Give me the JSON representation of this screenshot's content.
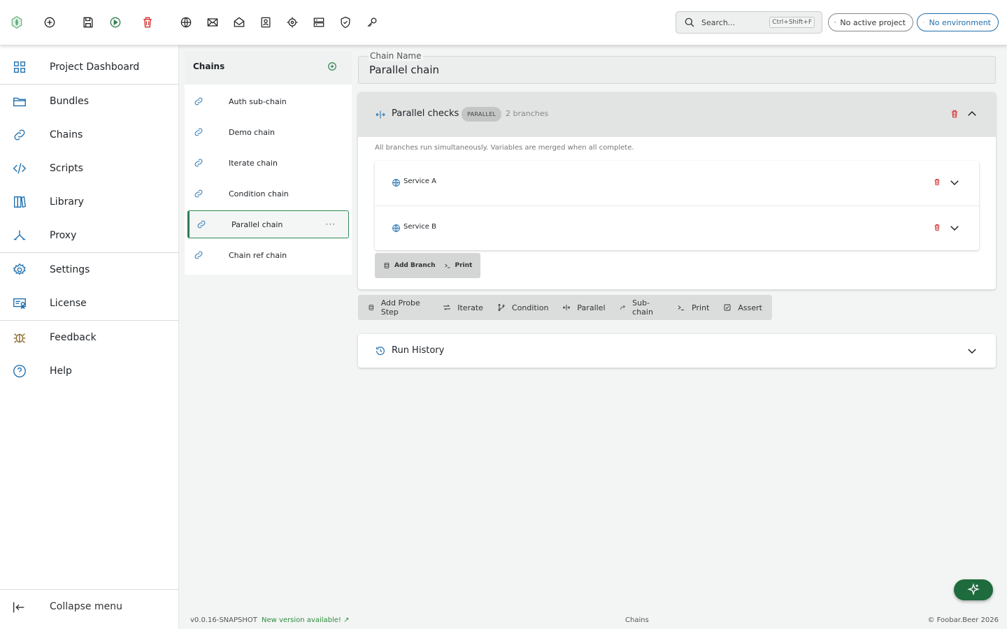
{
  "colors": {
    "accent_green": "#2e7d4f",
    "accent_blue": "#1f6fae",
    "danger_red": "#d32f2f"
  },
  "toolbar": {
    "icons": [
      "logo-icon",
      "add-icon",
      "save-icon",
      "run-icon",
      "delete-icon",
      "globe-icon",
      "mail-icon",
      "mail-open-icon",
      "contact-icon",
      "target-icon",
      "server-icon",
      "shield-check-icon",
      "key-icon"
    ],
    "search_placeholder": "Search...",
    "search_shortcut": "Ctrl+Shift+F",
    "project_label": "No active project",
    "environment_label": "No environment"
  },
  "sidebar": {
    "items": [
      {
        "label": "Project Dashboard",
        "icon": "grid-icon"
      },
      {
        "label": "Bundles",
        "icon": "folder-icon"
      },
      {
        "label": "Chains",
        "icon": "link-icon"
      },
      {
        "label": "Scripts",
        "icon": "code-icon"
      },
      {
        "label": "Library",
        "icon": "books-icon"
      },
      {
        "label": "Proxy",
        "icon": "fork-icon"
      },
      {
        "label": "Settings",
        "icon": "gear-icon"
      },
      {
        "label": "License",
        "icon": "certificate-icon"
      },
      {
        "label": "Feedback",
        "icon": "bug-icon"
      },
      {
        "label": "Help",
        "icon": "help-icon"
      }
    ],
    "collapse_label": "Collapse menu"
  },
  "chains": {
    "title": "Chains",
    "items": [
      {
        "label": "Auth sub-chain"
      },
      {
        "label": "Demo chain"
      },
      {
        "label": "Iterate chain"
      },
      {
        "label": "Condition chain"
      },
      {
        "label": "Parallel chain",
        "active": true
      },
      {
        "label": "Chain ref chain"
      }
    ],
    "more": "···"
  },
  "editor": {
    "chain_name_label": "Chain Name",
    "chain_name_value": "Parallel chain",
    "parallel": {
      "title": "Parallel checks",
      "badge": "PARALLEL",
      "branch_count": "2 branches",
      "description": "All branches run simultaneously. Variables are merged when all complete.",
      "branches": [
        {
          "label": "Service A"
        },
        {
          "label": "Service B"
        }
      ],
      "add_branch": "Add Branch",
      "print": "Print"
    },
    "step_buttons": [
      "Add Probe Step",
      "Iterate",
      "Condition",
      "Parallel",
      "Sub-chain",
      "Print",
      "Assert"
    ],
    "run_history": "Run History"
  },
  "footer": {
    "version": "v0.0.16-SNAPSHOT",
    "new_version": "New version available! ↗",
    "section": "Chains",
    "copyright": "© Foobar.Beer 2026"
  }
}
